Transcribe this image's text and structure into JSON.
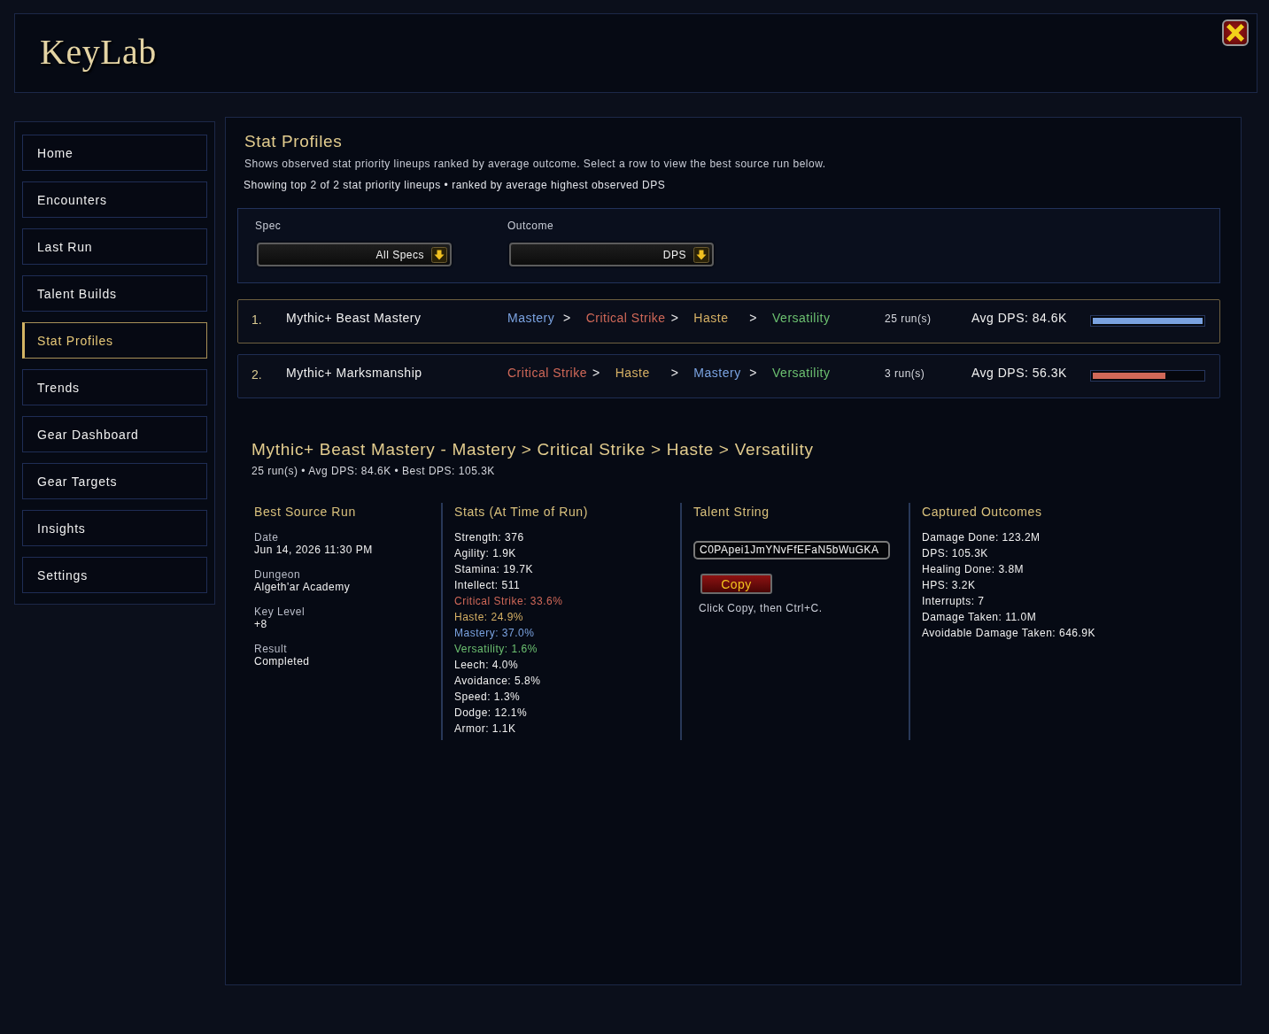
{
  "header": {
    "title": "KeyLab"
  },
  "sidebar": {
    "items": [
      {
        "label": "Home",
        "selected": false
      },
      {
        "label": "Encounters",
        "selected": false
      },
      {
        "label": "Last Run",
        "selected": false
      },
      {
        "label": "Talent Builds",
        "selected": false
      },
      {
        "label": "Stat Profiles",
        "selected": true
      },
      {
        "label": "Trends",
        "selected": false
      },
      {
        "label": "Gear Dashboard",
        "selected": false
      },
      {
        "label": "Gear Targets",
        "selected": false
      },
      {
        "label": "Insights",
        "selected": false
      },
      {
        "label": "Settings",
        "selected": false
      }
    ]
  },
  "main": {
    "title": "Stat Profiles",
    "description": "Shows observed stat priority lineups ranked by average outcome. Select a row to view the best source run below.",
    "summary": "Showing top 2 of 2 stat priority lineups • ranked by average highest observed DPS",
    "filters": [
      {
        "label": "Spec",
        "value": "All Specs"
      },
      {
        "label": "Outcome",
        "value": "DPS"
      }
    ],
    "profiles": [
      {
        "rank": "1.",
        "name": "Mythic+ Beast Mastery",
        "priority": [
          {
            "kind": "stat",
            "text": "Mastery",
            "color": "#7aa2e0"
          },
          {
            "kind": "separator",
            "text": ">"
          },
          {
            "kind": "stat",
            "text": "Critical Strike",
            "color": "#d06858"
          },
          {
            "kind": "separator",
            "text": ">"
          },
          {
            "kind": "stat",
            "text": "Haste",
            "color": "#d6b064"
          },
          {
            "kind": "separator",
            "text": ">"
          },
          {
            "kind": "stat",
            "text": "Versatility",
            "color": "#6cc070"
          }
        ],
        "runs": "25 run(s)",
        "average": "Avg DPS: 84.6K",
        "level": 1,
        "selected": true
      },
      {
        "rank": "2.",
        "name": "Mythic+ Marksmanship",
        "priority": [
          {
            "kind": "stat",
            "text": "Critical Strike",
            "color": "#d06858"
          },
          {
            "kind": "separator",
            "text": ">"
          },
          {
            "kind": "stat",
            "text": "Haste",
            "color": "#d6b064"
          },
          {
            "kind": "separator",
            "text": ">"
          },
          {
            "kind": "stat",
            "text": "Mastery",
            "color": "#7aa2e0"
          },
          {
            "kind": "separator",
            "text": ">"
          },
          {
            "kind": "stat",
            "text": "Versatility",
            "color": "#6cc070"
          }
        ],
        "runs": "3 run(s)",
        "average": "Avg DPS: 56.3K",
        "level": 0.665,
        "selected": false
      }
    ]
  },
  "detail": {
    "title": "Mythic+ Beast Mastery - Mastery > Critical Strike > Haste > Versatility",
    "summary": "25 run(s) • Avg DPS: 84.6K • Best DPS: 105.3K",
    "source": {
      "heading": "Best Source Run",
      "fields": [
        {
          "label": "Date",
          "value": "Jun 14, 2026 11:30 PM"
        },
        {
          "label": "Dungeon",
          "value": "Algeth'ar Academy"
        },
        {
          "label": "Key Level",
          "value": "+8"
        },
        {
          "label": "Result",
          "value": "Completed"
        }
      ]
    },
    "stats": {
      "heading": "Stats (At Time of Run)",
      "items": [
        {
          "text": "Strength: 376"
        },
        {
          "text": "Agility: 1.9K"
        },
        {
          "text": "Stamina: 19.7K"
        },
        {
          "text": "Intellect: 511"
        },
        {
          "text": "Critical Strike: 33.6%",
          "color": "#d06858"
        },
        {
          "text": "Haste: 24.9%",
          "color": "#d6b064"
        },
        {
          "text": "Mastery: 37.0%",
          "color": "#7aa2e0"
        },
        {
          "text": "Versatility: 1.6%",
          "color": "#6cc070"
        },
        {
          "text": "Leech: 4.0%"
        },
        {
          "text": "Avoidance: 5.8%"
        },
        {
          "text": "Speed: 1.3%"
        },
        {
          "text": "Dodge: 12.1%"
        },
        {
          "text": "Armor: 1.1K"
        }
      ]
    },
    "talent": {
      "heading": "Talent String",
      "value": "C0PApei1JmYNvFfEFaN5bWuGKA",
      "button": "Copy",
      "hint": "Click Copy, then Ctrl+C."
    },
    "outcomes": {
      "heading": "Captured Outcomes",
      "items": [
        "Damage Done: 123.2M",
        "DPS: 105.3K",
        "Healing Done: 3.8M",
        "HPS: 3.2K",
        "Interrupts: 7",
        "Damage Taken: 11.0M",
        "Avoidable Damage Taken: 646.9K"
      ]
    }
  }
}
